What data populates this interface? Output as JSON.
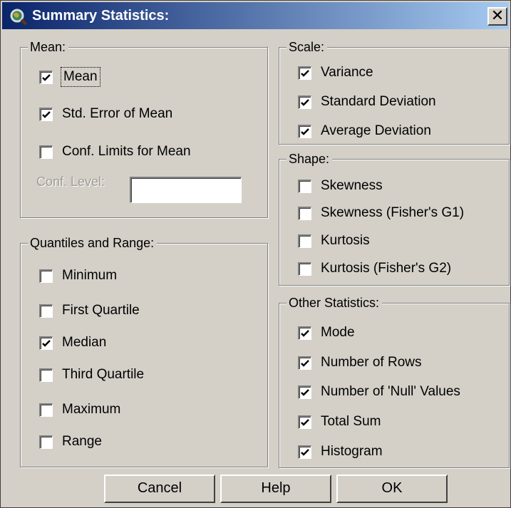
{
  "window": {
    "title": "Summary Statistics:",
    "close_glyph": "✕"
  },
  "mean_group": {
    "label": "Mean:",
    "items": [
      {
        "label": "Mean",
        "checked": true
      },
      {
        "label": "Std. Error of Mean",
        "checked": true
      },
      {
        "label": "Conf. Limits for Mean",
        "checked": false
      }
    ],
    "conf_level_label": "Conf. Level:",
    "conf_level_value": ""
  },
  "quantiles_group": {
    "label": "Quantiles and Range:",
    "items": [
      {
        "label": "Minimum",
        "checked": false
      },
      {
        "label": "First Quartile",
        "checked": false
      },
      {
        "label": "Median",
        "checked": true
      },
      {
        "label": "Third Quartile",
        "checked": false
      },
      {
        "label": "Maximum",
        "checked": false
      },
      {
        "label": "Range",
        "checked": false
      }
    ]
  },
  "scale_group": {
    "label": "Scale:",
    "items": [
      {
        "label": "Variance",
        "checked": true
      },
      {
        "label": "Standard Deviation",
        "checked": true
      },
      {
        "label": "Average Deviation",
        "checked": true
      }
    ]
  },
  "shape_group": {
    "label": "Shape:",
    "items": [
      {
        "label": "Skewness",
        "checked": false
      },
      {
        "label": "Skewness (Fisher's G1)",
        "checked": false
      },
      {
        "label": "Kurtosis",
        "checked": false
      },
      {
        "label": "Kurtosis (Fisher's G2)",
        "checked": false
      }
    ]
  },
  "other_group": {
    "label": "Other Statistics:",
    "items": [
      {
        "label": "Mode",
        "checked": true
      },
      {
        "label": "Number of Rows",
        "checked": true
      },
      {
        "label": "Number of 'Null' Values",
        "checked": true
      },
      {
        "label": "Total Sum",
        "checked": true
      },
      {
        "label": "Histogram",
        "checked": true
      }
    ]
  },
  "buttons": {
    "cancel": "Cancel",
    "help": "Help",
    "ok": "OK"
  },
  "colors": {
    "face": "#d4d0c8",
    "title_start": "#0a246a",
    "title_end": "#a6caf0"
  }
}
